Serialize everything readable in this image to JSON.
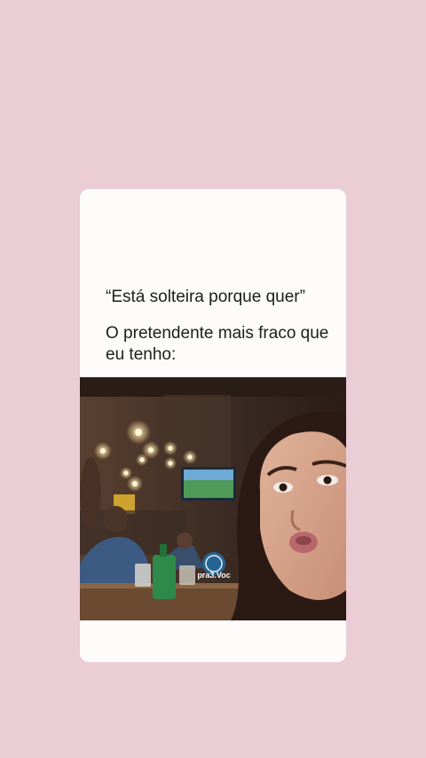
{
  "post": {
    "quote_line": "“Está solteira porque quer”",
    "caption_line_1": "O pretendente mais fraco que",
    "caption_line_2": "eu tenho:"
  },
  "video": {
    "watermark": "pra3.Voc"
  },
  "colors": {
    "background": "#ebcdd5",
    "card": "#fdfcfa",
    "text": "#1d1d1d"
  }
}
